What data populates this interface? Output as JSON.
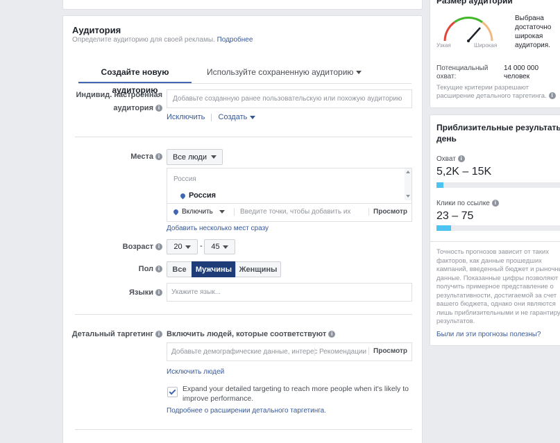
{
  "audience": {
    "title": "Аудитория",
    "subtitle": "Определите аудиторию для своей рекламы.",
    "more_link": "Подробнее",
    "tabs": {
      "create": "Создайте новую аудиторию",
      "saved": "Используйте сохраненную аудиторию"
    },
    "custom": {
      "label_line1": "Индивид. настроенная",
      "label_line2": "аудитория",
      "placeholder": "Добавьте созданную ранее пользовательскую или похожую аудиторию",
      "exclude": "Исключить",
      "create": "Создать"
    },
    "places": {
      "label": "Места",
      "dropdown": "Все люди",
      "country_header": "Россия",
      "country_item": "Россия",
      "include": "Включить",
      "input_placeholder": "Введите точки, чтобы добавить их",
      "browse": "Просмотр",
      "bulk_link": "Добавить несколько мест сразу"
    },
    "age": {
      "label": "Возраст",
      "min": "20",
      "dash": "-",
      "max": "45"
    },
    "gender": {
      "label": "Пол",
      "all": "Все",
      "men": "Мужчины",
      "women": "Женщины"
    },
    "languages": {
      "label": "Языки",
      "placeholder": "Укажите язык..."
    },
    "detailed": {
      "label": "Детальный таргетинг",
      "include_heading": "Включить людей, которые соответствуют",
      "placeholder": "Добавьте демографические данные, интерес",
      "recommendations": "Рекомендации",
      "browse": "Просмотр",
      "exclude_link": "Исключить людей",
      "expand_text_1": "Expand your detailed targeting to reach more people when it's likely to",
      "expand_text_2": "improve performance.",
      "expand_checked": true,
      "more_link": "Подробнее о расширении детального таргетинга."
    }
  },
  "sidebar": {
    "size": {
      "title": "Размер аудитории",
      "narrow": "Узкая",
      "wide": "Широкая",
      "verdict_1": "Выбрана",
      "verdict_2": "достаточно",
      "verdict_3": "широкая",
      "verdict_4": "аудитория.",
      "potential_label_1": "Потенциальный",
      "potential_label_2": "охват:",
      "potential_value_1": "14 000 000",
      "potential_value_2": "человек",
      "criteria_1": "Текущие критерии разрешают",
      "criteria_2": "расширение детального таргетинга.",
      "colors": {
        "narrow": "#e0463b",
        "mid": "#42b72a",
        "wide": "#f2b880"
      }
    },
    "estimates": {
      "title_1": "Приблизительные результаты за",
      "title_2": "день",
      "reach_label": "Охват",
      "reach_value": "5,2K – 15K",
      "reach_fill": 0.05,
      "clicks_label": "Клики по ссылке",
      "clicks_value": "23 – 75",
      "clicks_fill": 0.11,
      "bar_color": "#4cc3f0",
      "disclaimer": [
        "Точность прогнозов зависит от таких",
        "факторов, как данные прошедших",
        "кампаний, введенный бюджет и рыночные",
        "данные. Показанные цифры позволяют",
        "получить примерное представление о",
        "результативности, достигаемой за счет",
        "вашего бюджета, однако они являются",
        "лишь приблизительными и не гарантируют",
        "результатов."
      ],
      "feedback_link": "Были ли эти прогнозы полезны?"
    }
  }
}
